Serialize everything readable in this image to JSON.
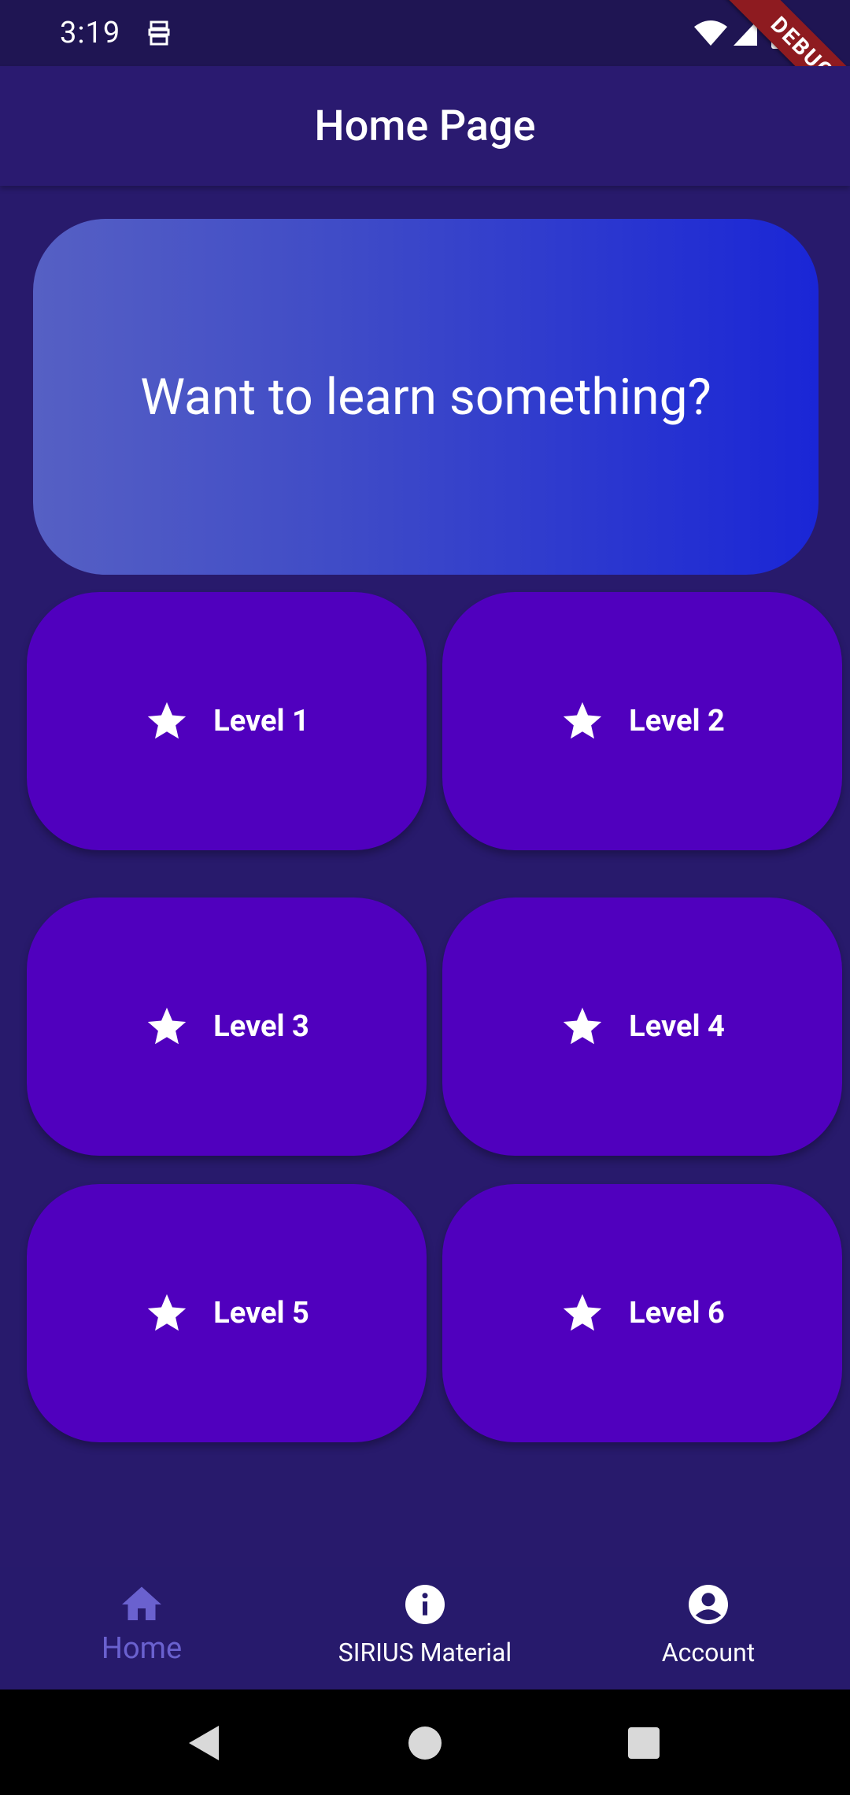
{
  "status_bar": {
    "time": "3:19",
    "icons": [
      "app-notification-icon",
      "wifi-icon",
      "signal-icon",
      "battery-icon"
    ]
  },
  "debug_banner": {
    "label": "DEBUG"
  },
  "app_bar": {
    "title": "Home Page"
  },
  "hero": {
    "text": "Want to learn something?"
  },
  "levels": [
    {
      "label": "Level 1",
      "icon": "star-icon"
    },
    {
      "label": "Level 2",
      "icon": "star-icon"
    },
    {
      "label": "Level 3",
      "icon": "star-icon"
    },
    {
      "label": "Level 4",
      "icon": "star-icon"
    },
    {
      "label": "Level 5",
      "icon": "star-icon"
    },
    {
      "label": "Level 6",
      "icon": "star-icon"
    }
  ],
  "bottom_nav": {
    "items": [
      {
        "label": "Home",
        "icon": "home-icon",
        "active": true
      },
      {
        "label": "SIRIUS Material",
        "icon": "info-icon",
        "active": false
      },
      {
        "label": "Account",
        "icon": "account-circle-icon",
        "active": false
      }
    ]
  },
  "system_nav": {
    "buttons": [
      "back-icon",
      "home-circle-icon",
      "recents-icon"
    ]
  },
  "colors": {
    "background": "#281a6c",
    "app_bar": "#2a1a70",
    "status_bar": "#1f1553",
    "card": "#5000be",
    "hero_gradient_start": "#5660c4",
    "hero_gradient_end": "#1a26d6",
    "nav_active": "#6a61cf",
    "debug_banner": "#8e1b20"
  }
}
